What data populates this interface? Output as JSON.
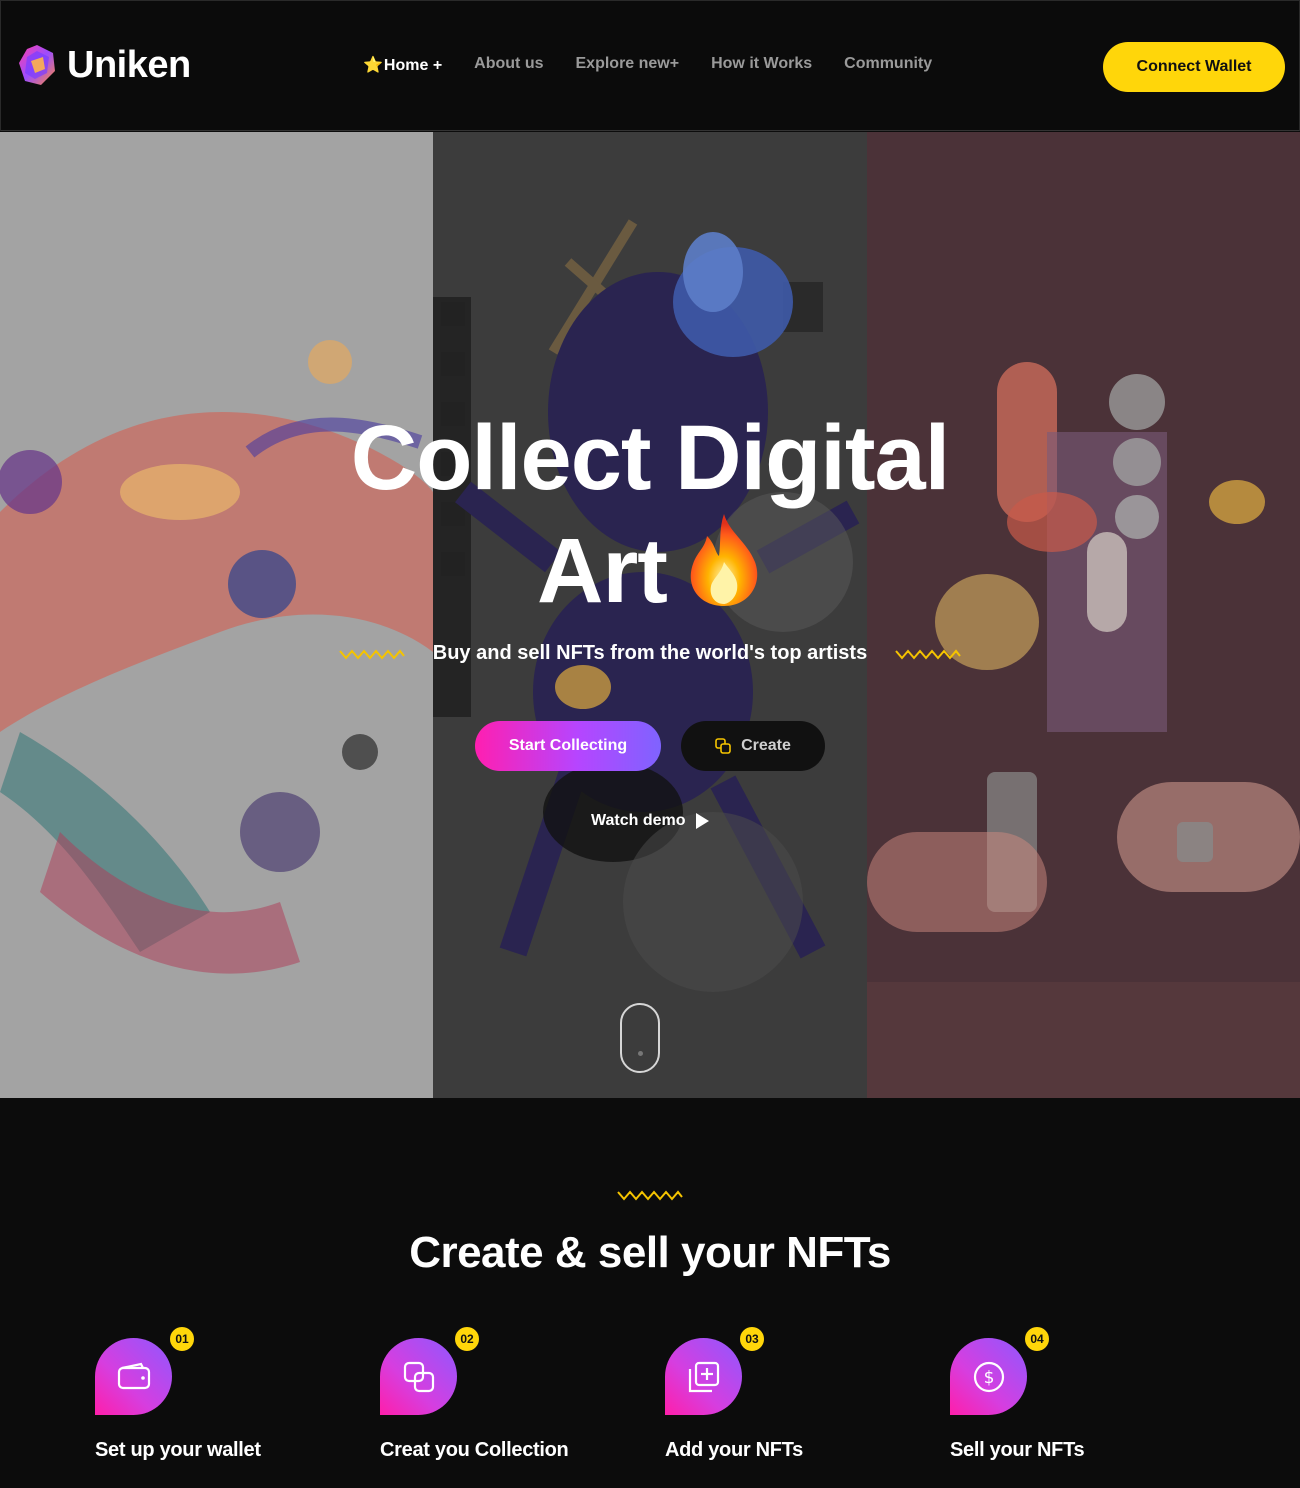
{
  "brand": {
    "name": "Uniken"
  },
  "nav": {
    "items": [
      {
        "label": "Home +",
        "prefix": "⭐"
      },
      {
        "label": "About us"
      },
      {
        "label": "Explore new+"
      },
      {
        "label": "How it Works"
      },
      {
        "label": "Community"
      }
    ],
    "active_index": 0
  },
  "header": {
    "connect_label": "Connect Wallet"
  },
  "hero": {
    "title_line1": "Collect Digital",
    "title_line2": "Art",
    "subtitle": "Buy and sell NFTs from the world's top artists",
    "start_label": "Start Collecting",
    "create_label": "Create",
    "watch_label": "Watch demo"
  },
  "steps_section": {
    "title": "Create & sell your NFTs",
    "steps": [
      {
        "number": "01",
        "label": "Set up your wallet",
        "icon": "wallet-icon"
      },
      {
        "number": "02",
        "label": "Creat you Collection",
        "icon": "copy-icon"
      },
      {
        "number": "03",
        "label": "Add your NFTs",
        "icon": "add-image-icon"
      },
      {
        "number": "04",
        "label": "Sell your NFTs",
        "icon": "dollar-icon"
      }
    ]
  },
  "colors": {
    "accent_yellow": "#ffd60a",
    "gradient_pink": "#ff1fb0",
    "gradient_purple": "#8f58ff",
    "background": "#0c0c0c"
  }
}
